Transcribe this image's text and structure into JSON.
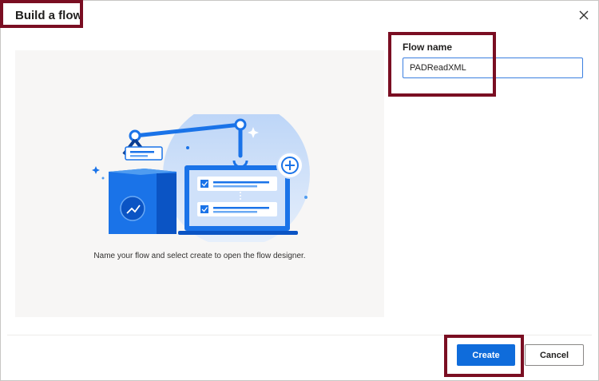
{
  "dialog": {
    "title": "Build a flow",
    "caption": "Name your flow and select create to open the flow designer.",
    "flow_name_label": "Flow name",
    "flow_name_value": "PADReadXML",
    "create_label": "Create",
    "cancel_label": "Cancel"
  },
  "icons": {
    "close": "close-icon",
    "illustration": "flow-designer-illustration"
  },
  "colors": {
    "primary": "#0f6cdb",
    "highlight": "#7a0e22",
    "illustration_blue": "#1a73e8"
  }
}
